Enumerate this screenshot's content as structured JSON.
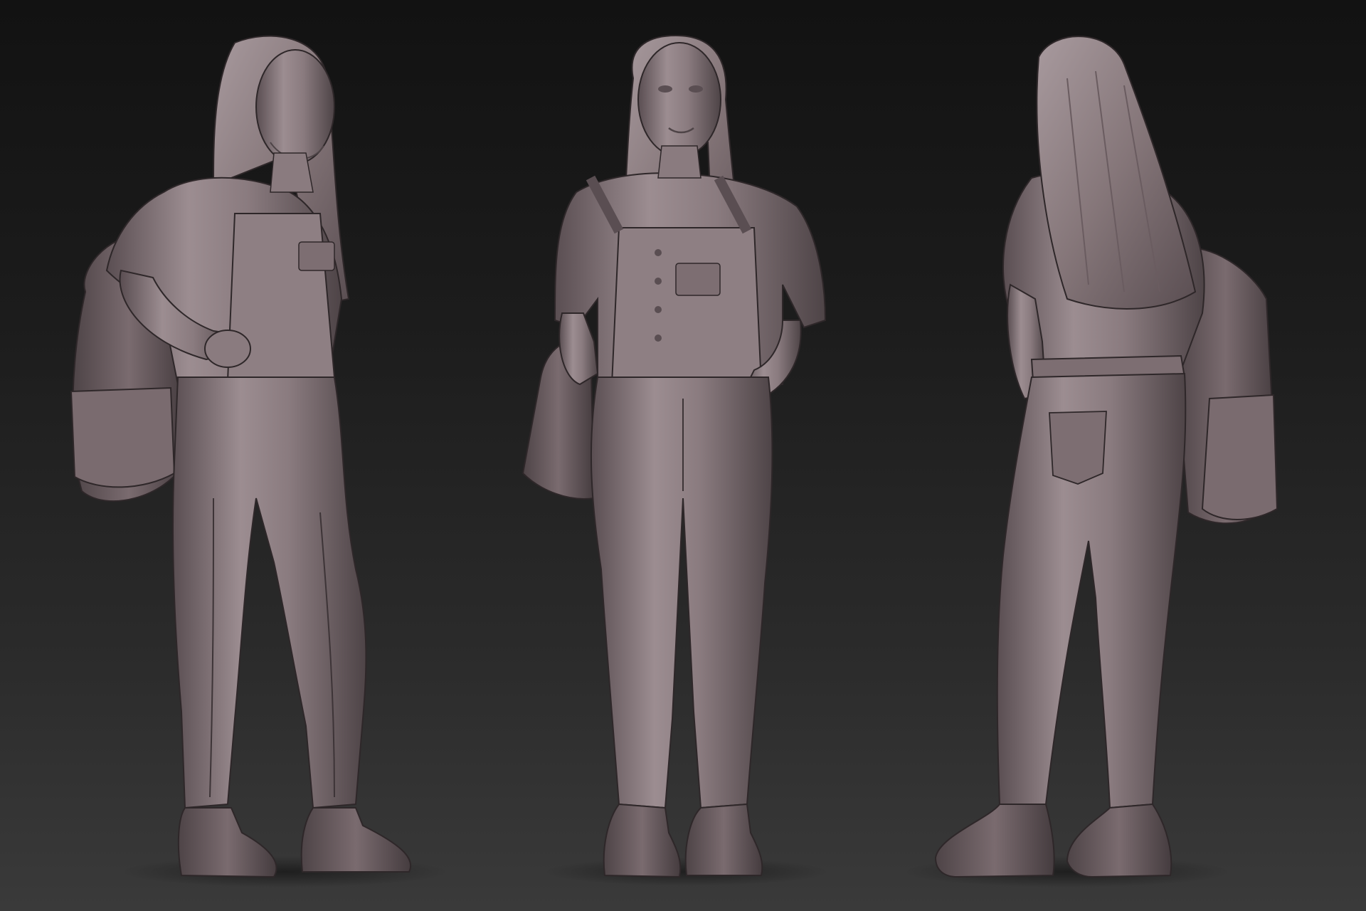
{
  "scene": {
    "background_top": "#121212",
    "background_bottom": "#3a3a3a",
    "clay_color": "#8a7b7f",
    "clay_highlight": "#b3a5a9",
    "clay_shadow": "#4e4447",
    "views": [
      {
        "id": "three-quarter-front",
        "facing": "right"
      },
      {
        "id": "front",
        "facing": "viewer"
      },
      {
        "id": "three-quarter-back",
        "facing": "away"
      }
    ]
  }
}
